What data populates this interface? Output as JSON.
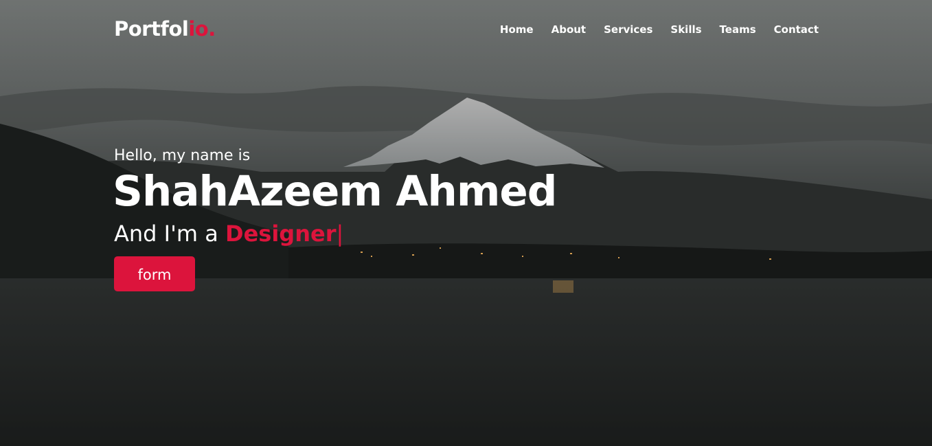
{
  "navbar": {
    "logo_main": "Portfol",
    "logo_accent": "io.",
    "menu": [
      {
        "label": "Home"
      },
      {
        "label": "About"
      },
      {
        "label": "Services"
      },
      {
        "label": "Skills"
      },
      {
        "label": "Teams"
      },
      {
        "label": "Contact"
      }
    ]
  },
  "hero": {
    "greeting": "Hello, my name is",
    "name": "ShahAzeem Ahmed",
    "role_prefix": "And I'm a ",
    "role_typed": "Designer",
    "cursor": "|",
    "button_label": "form"
  },
  "colors": {
    "accent": "#dc143c",
    "text": "#ffffff",
    "overlay": "#2b2e2d"
  }
}
